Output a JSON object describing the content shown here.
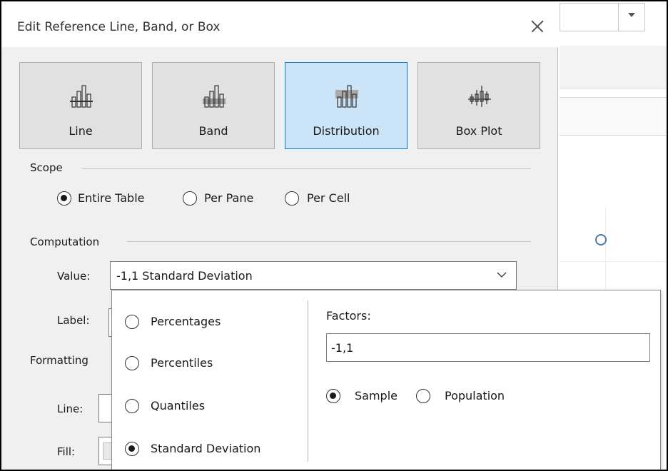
{
  "dialog": {
    "title": "Edit Reference Line, Band, or Box",
    "type_buttons": [
      {
        "label": "Line",
        "icon": "reference-line-icon",
        "selected": false
      },
      {
        "label": "Band",
        "icon": "reference-band-icon",
        "selected": false
      },
      {
        "label": "Distribution",
        "icon": "distribution-icon",
        "selected": true
      },
      {
        "label": "Box Plot",
        "icon": "box-plot-icon",
        "selected": false
      }
    ],
    "scope": {
      "label": "Scope",
      "options": [
        {
          "label": "Entire Table",
          "checked": true
        },
        {
          "label": "Per Pane",
          "checked": false
        },
        {
          "label": "Per Cell",
          "checked": false
        }
      ]
    },
    "computation": {
      "label": "Computation",
      "value_label": "Value:",
      "value_selected": "-1,1 Standard Deviation",
      "label_label": "Label:"
    },
    "formatting": {
      "label": "Formatting",
      "line_label": "Line:",
      "fill_label": "Fill:"
    }
  },
  "popup": {
    "methods": [
      {
        "label": "Percentages",
        "checked": false
      },
      {
        "label": "Percentiles",
        "checked": false
      },
      {
        "label": "Quantiles",
        "checked": false
      },
      {
        "label": "Standard Deviation",
        "checked": true
      }
    ],
    "factors_label": "Factors:",
    "factors_value": "-1,1",
    "sample_options": [
      {
        "label": "Sample",
        "checked": true
      },
      {
        "label": "Population",
        "checked": false
      }
    ]
  },
  "colors": {
    "selected_bg": "#cce4f7",
    "selected_border": "#0078d7",
    "dialog_bg": "#f0f0f0",
    "circle_mark": "#4e79a7"
  }
}
